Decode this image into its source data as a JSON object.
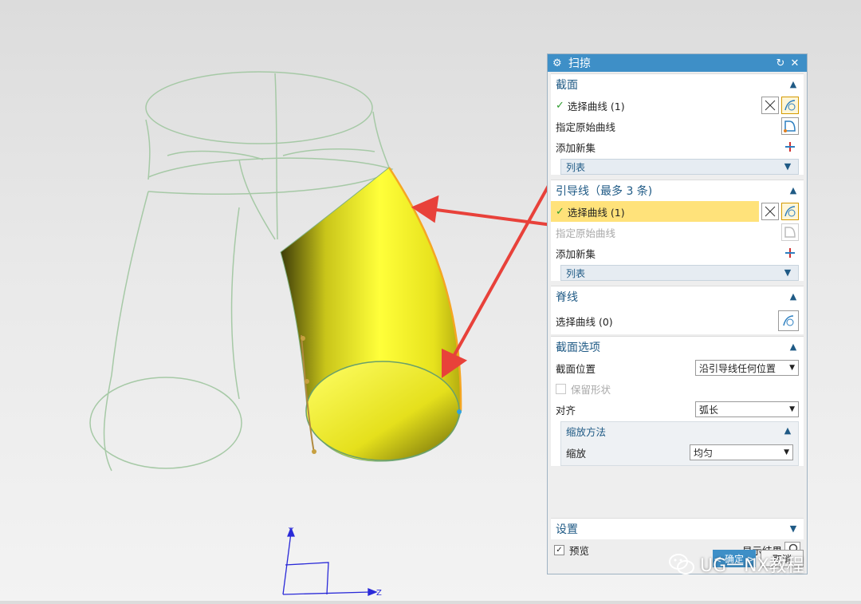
{
  "dialog": {
    "title": "扫掠",
    "reset_icon": "reset-icon",
    "close_icon": "close-icon",
    "section_group": {
      "title": "截面",
      "select_curve_label": "选择曲线 (1)",
      "specify_origin_label": "指定原始曲线",
      "add_new_set_label": "添加新集",
      "list_label": "列表"
    },
    "guide_group": {
      "title": "引导线（最多 3 条)",
      "select_curve_label": "选择曲线 (1)",
      "specify_origin_label": "指定原始曲线",
      "add_new_set_label": "添加新集",
      "list_label": "列表"
    },
    "spine_group": {
      "title": "脊线",
      "select_curve_label": "选择曲线 (0)"
    },
    "section_options": {
      "title": "截面选项",
      "position_label": "截面位置",
      "position_value": "沿引导线任何位置",
      "keep_shape_label": "保留形状",
      "align_label": "对齐",
      "align_value": "弧长",
      "scaling": {
        "title": "缩放方法",
        "scale_label": "缩放",
        "scale_value": "均匀"
      }
    },
    "settings_group": {
      "title": "设置"
    },
    "preview_label": "预览",
    "show_result_label": "显示结果",
    "ok_label": "< 确定 >",
    "cancel_label": "取消"
  },
  "watermark": {
    "text": "UG一NX教程"
  },
  "viewport": {
    "triad": {
      "y_label": "Y",
      "z_label": "Z"
    }
  },
  "colors": {
    "title_bar": "#3e8fc7",
    "group_header_text": "#1f5a85",
    "highlight_row": "#ffe27a",
    "surface_yellow": "#f2f21a",
    "wireframe_green": "#a6c9a6",
    "arrow_red": "#e8413a"
  }
}
